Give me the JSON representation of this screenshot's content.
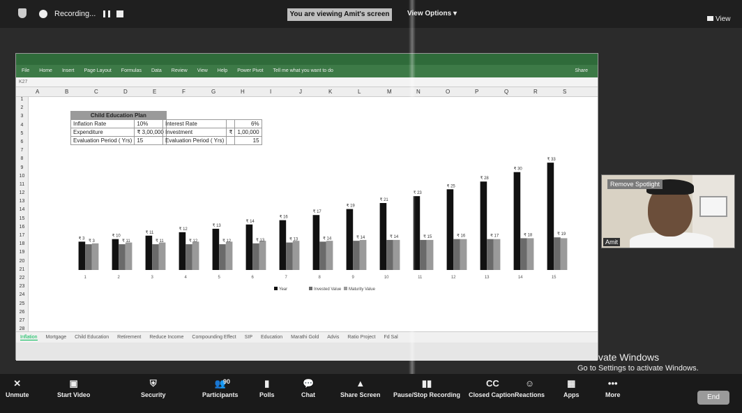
{
  "meeting": {
    "recording_label": "Recording...",
    "viewing_banner": "You are viewing Amit's screen",
    "view_options": "View Options",
    "view_button": "View",
    "activate_title": "vate Windows",
    "activate_sub": "Go to Settings to activate Windows."
  },
  "excel": {
    "formula_ref": "K27",
    "ribbon_tabs": [
      "File",
      "Home",
      "Insert",
      "Page Layout",
      "Formulas",
      "Data",
      "Review",
      "View",
      "Help",
      "Power Pivot",
      "Tell me what you want to do"
    ],
    "share": "Share",
    "columns": [
      "A",
      "B",
      "C",
      "D",
      "E",
      "F",
      "G",
      "H",
      "I",
      "J",
      "K",
      "L",
      "M",
      "N",
      "O",
      "P",
      "Q",
      "R",
      "S"
    ],
    "rows": [
      "1",
      "2",
      "3",
      "4",
      "5",
      "6",
      "7",
      "8",
      "9",
      "10",
      "11",
      "12",
      "13",
      "14",
      "15",
      "16",
      "17",
      "18",
      "19",
      "20",
      "21",
      "22",
      "23",
      "24",
      "25",
      "26",
      "27",
      "28"
    ],
    "plan": {
      "title": "Child Education Plan",
      "rows": [
        {
          "label": "Inflation Rate",
          "value": "10%"
        },
        {
          "label": "Expenditure",
          "value": "₹ 3,00,000"
        },
        {
          "label": "Evaluation Period ( Yrs)",
          "value": "15"
        }
      ]
    },
    "investment": {
      "rows": [
        {
          "label": "Interest Rate",
          "sym": "",
          "value": "6%"
        },
        {
          "label": "Investment",
          "sym": "₹",
          "value": "1,00,000"
        },
        {
          "label": "Evaluation Period ( Yrs)",
          "sym": "",
          "value": "15"
        }
      ]
    },
    "sheet_tabs": [
      "Inflation",
      "Mortgage",
      "Child Education",
      "Retirement",
      "Reduce Income",
      "Compounding Effect",
      "SIP",
      "Education",
      "Marathi Gold",
      "Advis",
      "Ratio Project",
      "Fd Sal"
    ]
  },
  "chart_data": {
    "type": "bar",
    "categories": [
      "1",
      "2",
      "3",
      "4",
      "5",
      "6",
      "7",
      "8",
      "9",
      "10",
      "11",
      "12",
      "13",
      "14",
      "15"
    ],
    "series": [
      {
        "name": "Year",
        "values": [
          3.3,
          3.6,
          4.0,
          4.4,
          4.8,
          5.3,
          5.8,
          6.4,
          7.1,
          7.8,
          8.6,
          9.4,
          10.3,
          11.4,
          12.5
        ],
        "color": "#111111"
      },
      {
        "name": "Invested Value",
        "values": [
          3.0,
          3.0,
          3.0,
          3.0,
          3.0,
          3.1,
          3.2,
          3.3,
          3.4,
          3.5,
          3.5,
          3.6,
          3.6,
          3.7,
          3.8
        ],
        "color": "#6a6a6a"
      },
      {
        "name": "Maturity Value",
        "values": [
          3.1,
          3.2,
          3.2,
          3.3,
          3.3,
          3.4,
          3.4,
          3.4,
          3.5,
          3.5,
          3.5,
          3.6,
          3.6,
          3.7,
          3.7
        ],
        "color": "#9a9a9a"
      }
    ],
    "data_labels_series1": [
      "₹ 3",
      "₹ 10",
      "₹ 11",
      "₹ 12",
      "₹ 13",
      "₹ 14",
      "₹ 16",
      "₹ 17",
      "₹ 19",
      "₹ 21",
      "₹ 23",
      "₹ 25",
      "₹ 28",
      "₹ 30",
      "₹ 33"
    ],
    "data_labels_series2": [
      "₹ 3",
      "₹ 11",
      "₹ 11",
      "₹ 12",
      "₹ 12",
      "₹ 13",
      "₹ 13",
      "₹ 14",
      "₹ 14",
      "₹ 14",
      "₹ 15",
      "₹ 16",
      "₹ 17",
      "₹ 18",
      "₹ 19"
    ],
    "legend": [
      "Year",
      "Invested Value",
      "Maturity Value"
    ],
    "legend_position": "bottom"
  },
  "spotlight": {
    "remove_label": "Remove Spotlight",
    "name": "Amit"
  },
  "toolbar": {
    "items": [
      {
        "label": "Unmute",
        "icon": "mic-off-icon"
      },
      {
        "label": "Start Video",
        "icon": "video-off-icon"
      },
      {
        "label": "Security",
        "icon": "shield-icon"
      },
      {
        "label": "Participants",
        "icon": "participants-icon",
        "count": "90"
      },
      {
        "label": "Polls",
        "icon": "polls-icon"
      },
      {
        "label": "Chat",
        "icon": "chat-icon"
      },
      {
        "label": "Share Screen",
        "icon": "share-screen-icon"
      },
      {
        "label": "Pause/Stop Recording",
        "icon": "pause-stop-icon"
      },
      {
        "label": "Closed Caption",
        "icon": "cc-icon"
      },
      {
        "label": "Reactions",
        "icon": "reactions-icon"
      },
      {
        "label": "Apps",
        "icon": "apps-icon"
      },
      {
        "label": "More",
        "icon": "more-icon"
      }
    ],
    "end_label": "End"
  }
}
